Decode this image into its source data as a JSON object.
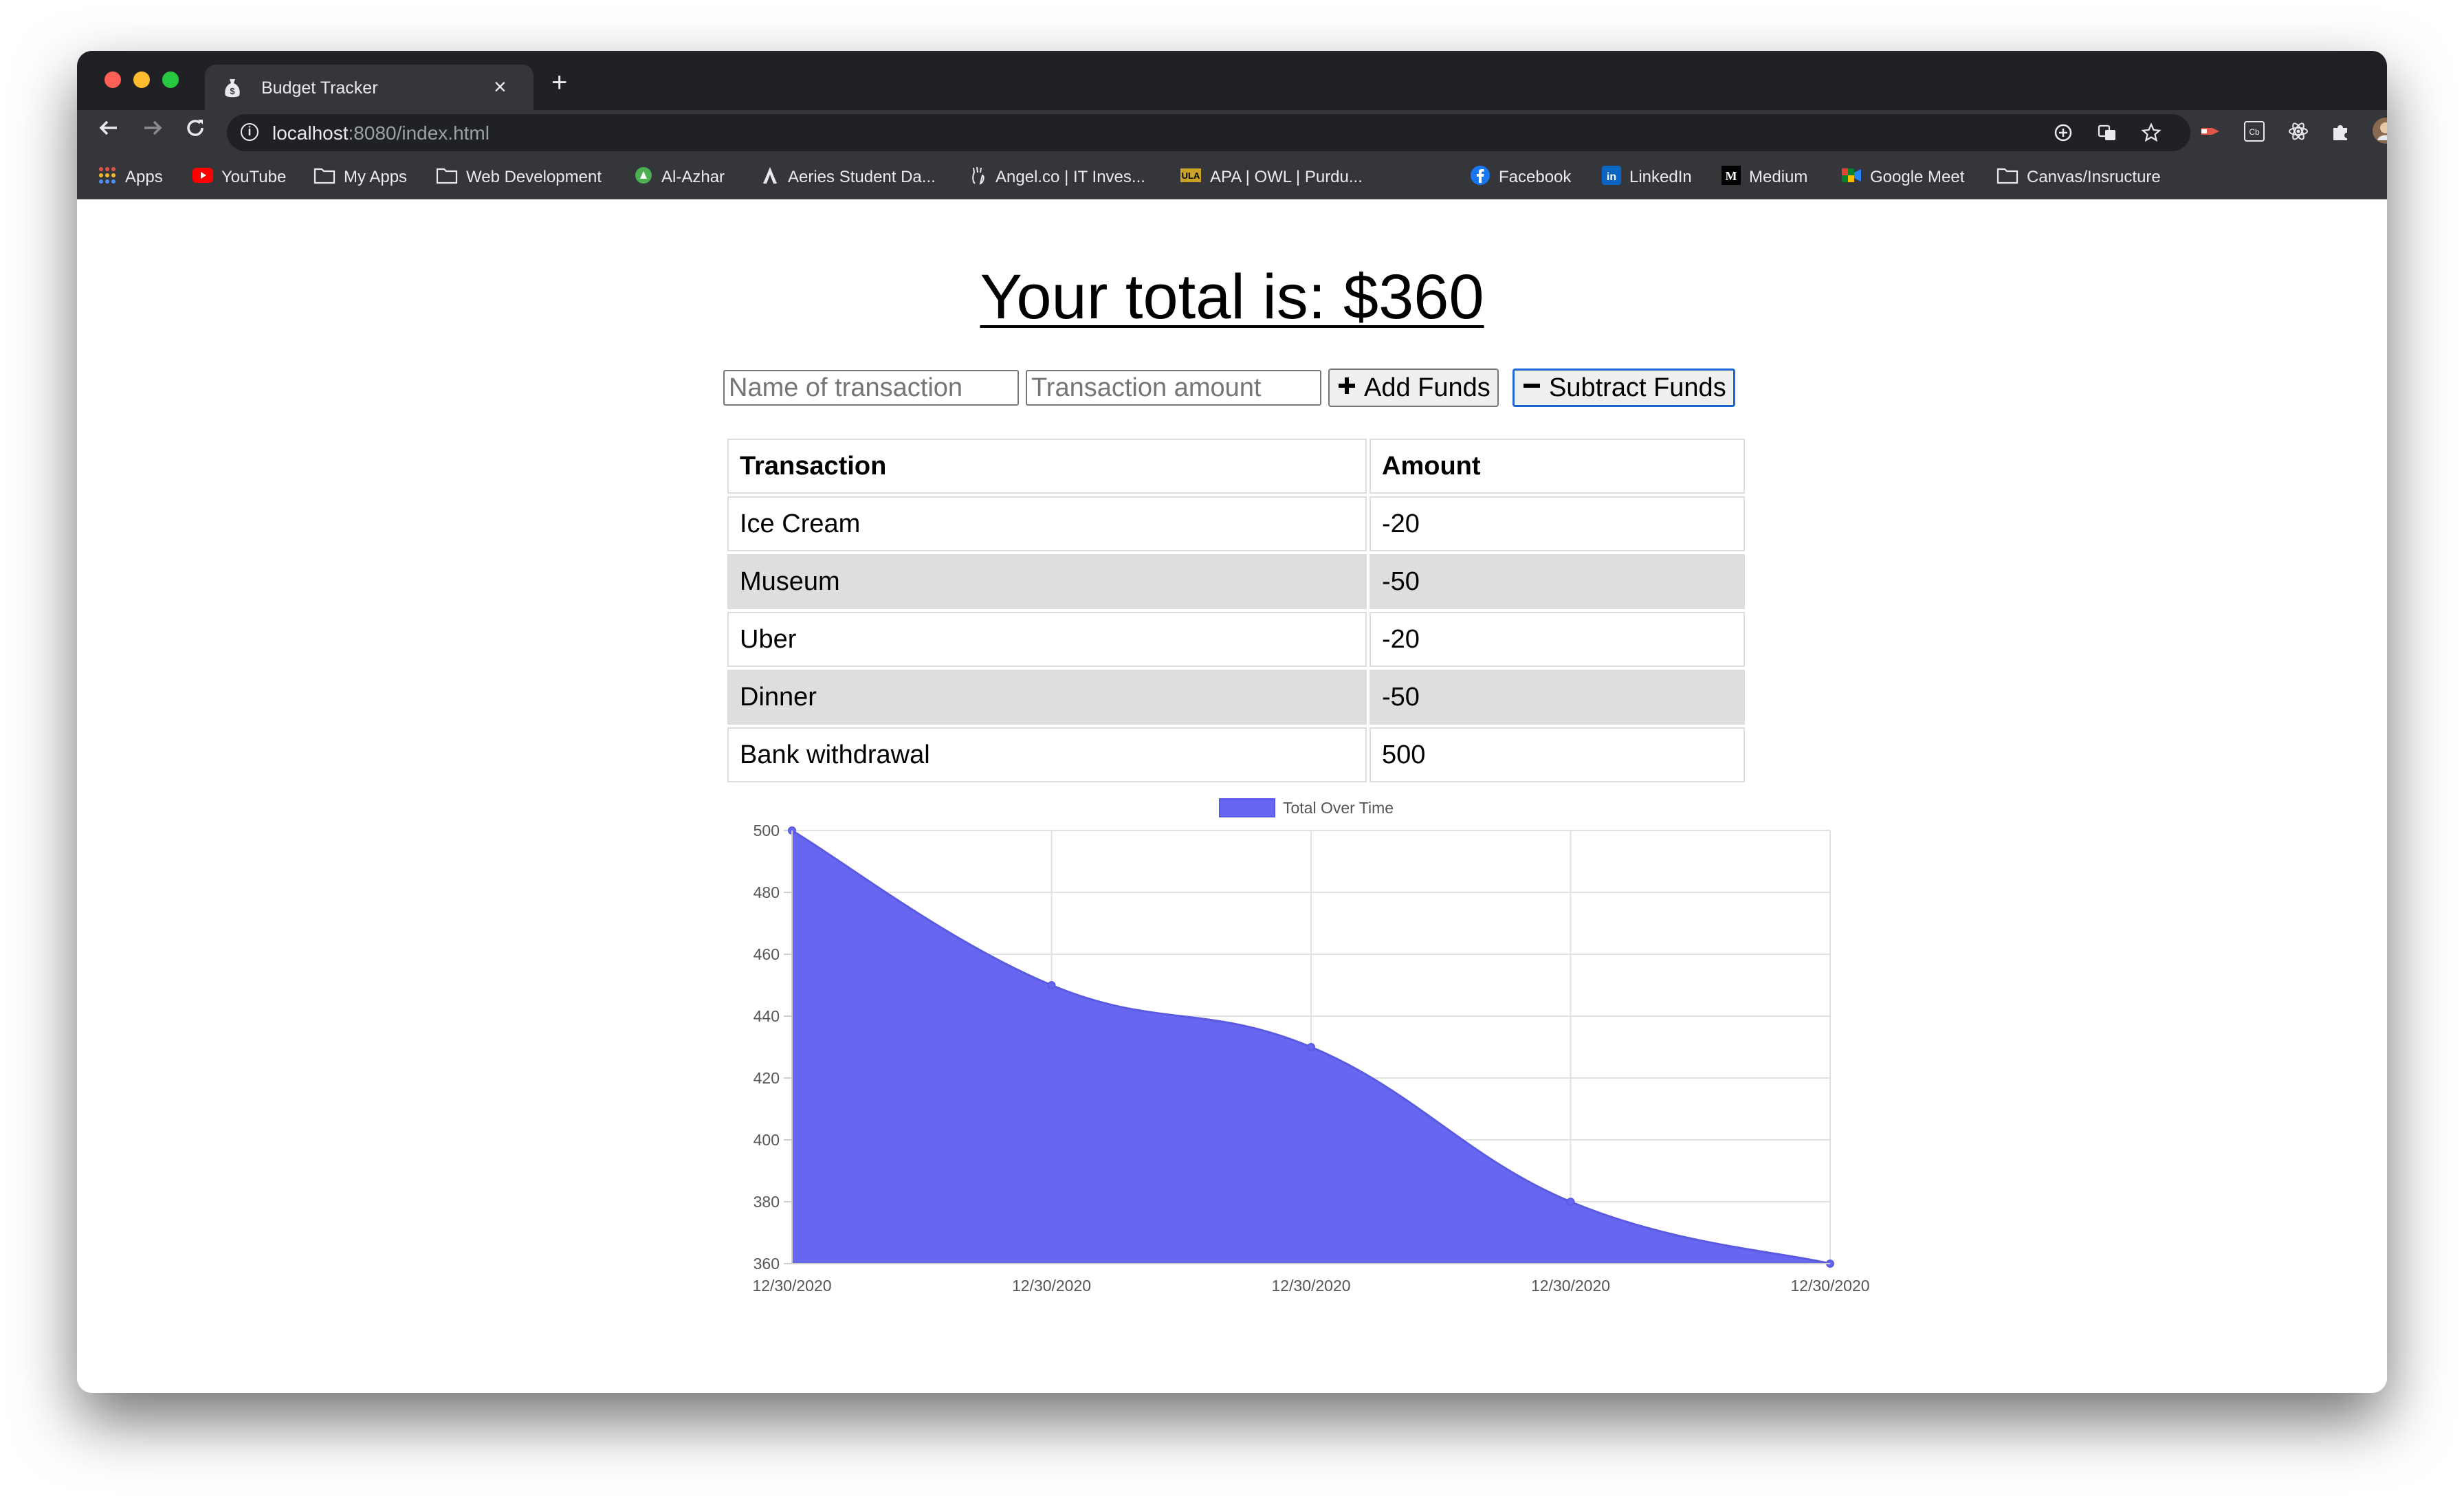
{
  "browser": {
    "tab": {
      "title": "Budget Tracker",
      "close_glyph": "×"
    },
    "new_tab_glyph": "+",
    "url_host": "localhost",
    "url_rest": ":8080/index.html",
    "bookmarks": [
      {
        "label": "Apps"
      },
      {
        "label": "YouTube"
      },
      {
        "label": "My Apps"
      },
      {
        "label": "Web Development"
      },
      {
        "label": "Al-Azhar"
      },
      {
        "label": "Aeries Student Da..."
      },
      {
        "label": "Angel.co | IT Inves..."
      },
      {
        "label": "APA | OWL | Purdu..."
      },
      {
        "label": "Facebook"
      },
      {
        "label": "LinkedIn"
      },
      {
        "label": "Medium"
      },
      {
        "label": "Google Meet"
      },
      {
        "label": "Canvas/Insructure"
      }
    ]
  },
  "app": {
    "total_label": "Your total is: $360",
    "name_placeholder": "Name of transaction",
    "amount_placeholder": "Transaction amount",
    "add_label": "Add Funds",
    "subtract_label": "Subtract Funds",
    "table": {
      "headers": [
        "Transaction",
        "Amount"
      ],
      "rows": [
        [
          "Ice Cream",
          "-20"
        ],
        [
          "Museum",
          "-50"
        ],
        [
          "Uber",
          "-20"
        ],
        [
          "Dinner",
          "-50"
        ],
        [
          "Bank withdrawal",
          "500"
        ]
      ]
    }
  },
  "chart_data": {
    "type": "area",
    "legend": "Total Over Time",
    "legend_position": "top",
    "x": [
      "12/30/2020",
      "12/30/2020",
      "12/30/2020",
      "12/30/2020",
      "12/30/2020"
    ],
    "values": [
      500,
      450,
      430,
      380,
      360
    ],
    "ylim": [
      360,
      500
    ],
    "yticks": [
      360,
      380,
      400,
      420,
      440,
      460,
      480,
      500
    ],
    "grid": true,
    "color": "#6666f1"
  }
}
